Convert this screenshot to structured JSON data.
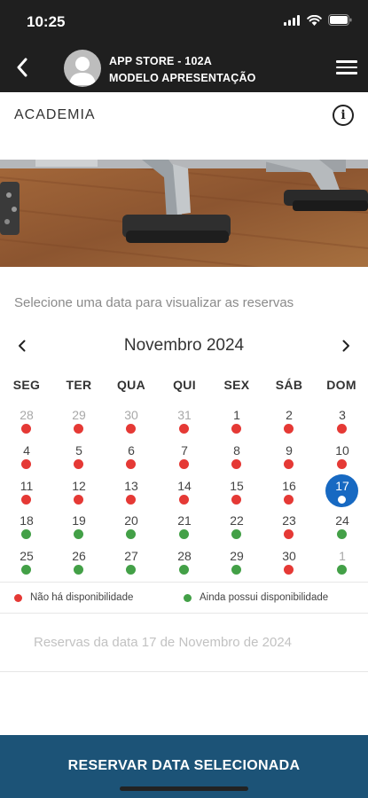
{
  "status_bar": {
    "time": "10:25",
    "icons": [
      "signal-icon",
      "wifi-icon",
      "battery-icon"
    ]
  },
  "header": {
    "title": "APP STORE - 102A",
    "subtitle": "MODELO APRESENTAÇÃO",
    "icons": [
      "back-arrow-icon",
      "avatar-icon",
      "hamburger-menu-icon"
    ]
  },
  "section": {
    "title": "ACADEMIA",
    "info_icon": "info-icon"
  },
  "instruction": "Selecione uma data para visualizar as reservas",
  "calendar": {
    "month_label": "Novembro 2024",
    "weekdays": [
      "SEG",
      "TER",
      "QUA",
      "QUI",
      "SEX",
      "SÁB",
      "DOM"
    ],
    "weeks": [
      [
        {
          "d": "28",
          "other": true,
          "status": "unavailable"
        },
        {
          "d": "29",
          "other": true,
          "status": "unavailable"
        },
        {
          "d": "30",
          "other": true,
          "status": "unavailable"
        },
        {
          "d": "31",
          "other": true,
          "status": "unavailable"
        },
        {
          "d": "1",
          "status": "unavailable"
        },
        {
          "d": "2",
          "status": "unavailable"
        },
        {
          "d": "3",
          "status": "unavailable"
        }
      ],
      [
        {
          "d": "4",
          "status": "unavailable"
        },
        {
          "d": "5",
          "status": "unavailable"
        },
        {
          "d": "6",
          "status": "unavailable"
        },
        {
          "d": "7",
          "status": "unavailable"
        },
        {
          "d": "8",
          "status": "unavailable"
        },
        {
          "d": "9",
          "status": "unavailable"
        },
        {
          "d": "10",
          "status": "unavailable"
        }
      ],
      [
        {
          "d": "11",
          "status": "unavailable"
        },
        {
          "d": "12",
          "status": "unavailable"
        },
        {
          "d": "13",
          "status": "unavailable"
        },
        {
          "d": "14",
          "status": "unavailable"
        },
        {
          "d": "15",
          "status": "unavailable"
        },
        {
          "d": "16",
          "status": "unavailable"
        },
        {
          "d": "17",
          "status": "selected"
        }
      ],
      [
        {
          "d": "18",
          "status": "available"
        },
        {
          "d": "19",
          "status": "available"
        },
        {
          "d": "20",
          "status": "available"
        },
        {
          "d": "21",
          "status": "available"
        },
        {
          "d": "22",
          "status": "available"
        },
        {
          "d": "23",
          "status": "unavailable"
        },
        {
          "d": "24",
          "status": "available"
        }
      ],
      [
        {
          "d": "25",
          "status": "available"
        },
        {
          "d": "26",
          "status": "available"
        },
        {
          "d": "27",
          "status": "available"
        },
        {
          "d": "28",
          "status": "available"
        },
        {
          "d": "29",
          "status": "available"
        },
        {
          "d": "30",
          "status": "unavailable"
        },
        {
          "d": "1",
          "other": true,
          "status": "available"
        }
      ]
    ]
  },
  "legend": {
    "unavailable_label": "Não há disponibilidade",
    "available_label": "Ainda possui disponibilidade"
  },
  "selected_date_text": "Reservas da data  17 de Novembro de 2024",
  "cta_label": "RESERVAR DATA SELECIONADA",
  "colors": {
    "header_bg": "#1f1f1f",
    "unavailable": "#e53935",
    "available": "#43a047",
    "selected": "#1769c2",
    "cta_bg": "#1c5377"
  }
}
